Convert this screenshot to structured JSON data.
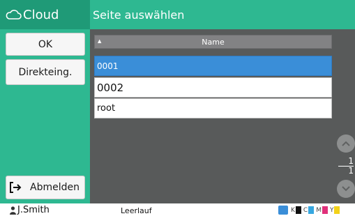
{
  "sidebar": {
    "title": "Cloud",
    "buttons": {
      "ok": "OK",
      "direct": "Direkteing.",
      "logout": "Abmelden"
    }
  },
  "main": {
    "title": "Seite auswählen",
    "list": {
      "column_header": "Name",
      "rows": [
        "0001",
        "0002",
        "root"
      ],
      "selected_row": "0001"
    },
    "pager": {
      "current": "1",
      "total": "1"
    }
  },
  "status": {
    "user": "J.Smith",
    "state": "Leerlauf",
    "toner_labels": [
      "K",
      "C",
      "M",
      "Y"
    ]
  },
  "colors": {
    "accent": "#2eb891",
    "selection": "#3a8ed8",
    "toner_k": "#111111",
    "toner_c": "#36a7e0",
    "toner_m": "#e0307a",
    "toner_y": "#f3d21a"
  }
}
